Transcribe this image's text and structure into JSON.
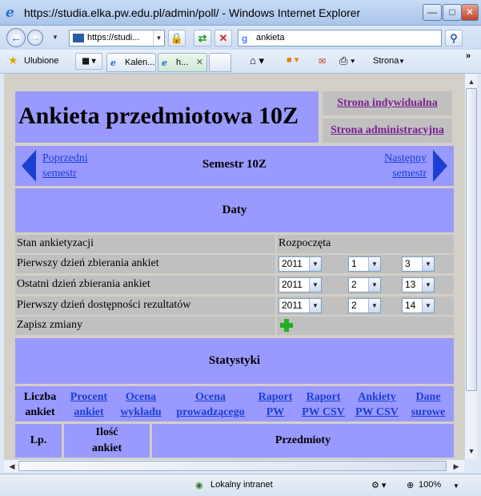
{
  "window": {
    "title": "https://studia.elka.pw.edu.pl/admin/poll/ - Windows Internet Explorer"
  },
  "nav": {
    "address": "https://studi...",
    "search": "ankieta"
  },
  "favbar": {
    "favorites": "Ulubione",
    "tab1": "Kalen...",
    "tab2": "h...",
    "page_menu": "Strona"
  },
  "page": {
    "title": "Ankieta przedmiotowa 10Z",
    "link_individual": "Strona indywidualna",
    "link_admin": "Strona administracyjna",
    "prev_line1": "Poprzedni",
    "prev_line2": "semestr",
    "next_line1": "Następny",
    "next_line2": "semestr",
    "semester": "Semestr 10Z",
    "dates_header": "Daty",
    "rows": [
      {
        "label": "Stan ankietyzacji",
        "value": "Rozpoczęta"
      },
      {
        "label": "Pierwszy dzień zbierania ankiet",
        "year": "2011",
        "month": "1",
        "day": "3"
      },
      {
        "label": "Ostatni dzień zbierania ankiet",
        "year": "2011",
        "month": "2",
        "day": "13"
      },
      {
        "label": "Pierwszy dzień dostępności rezultatów",
        "year": "2011",
        "month": "2",
        "day": "14"
      },
      {
        "label": "Zapisz zmiany"
      }
    ],
    "stats_header": "Statystyki",
    "stats_cols": [
      {
        "l1": "Liczba",
        "l2": "ankiet"
      },
      {
        "l1": "Procent",
        "l2": "ankiet"
      },
      {
        "l1": "Ocena",
        "l2": "wykładu"
      },
      {
        "l1": "Ocena",
        "l2": "prowadzącego"
      },
      {
        "l1": "Raport",
        "l2": "PW"
      },
      {
        "l1": "Raport",
        "l2": "PW CSV"
      },
      {
        "l1": "Ankiety",
        "l2": "PW CSV"
      },
      {
        "l1": "Dane",
        "l2": "surowe"
      }
    ],
    "table_headers": {
      "lp": "Lp.",
      "ilosc1": "Ilość",
      "ilosc2": "ankiet",
      "przedmioty": "Przedmioty"
    }
  },
  "status": {
    "zone": "Lokalny intranet",
    "zoom": "100%"
  }
}
